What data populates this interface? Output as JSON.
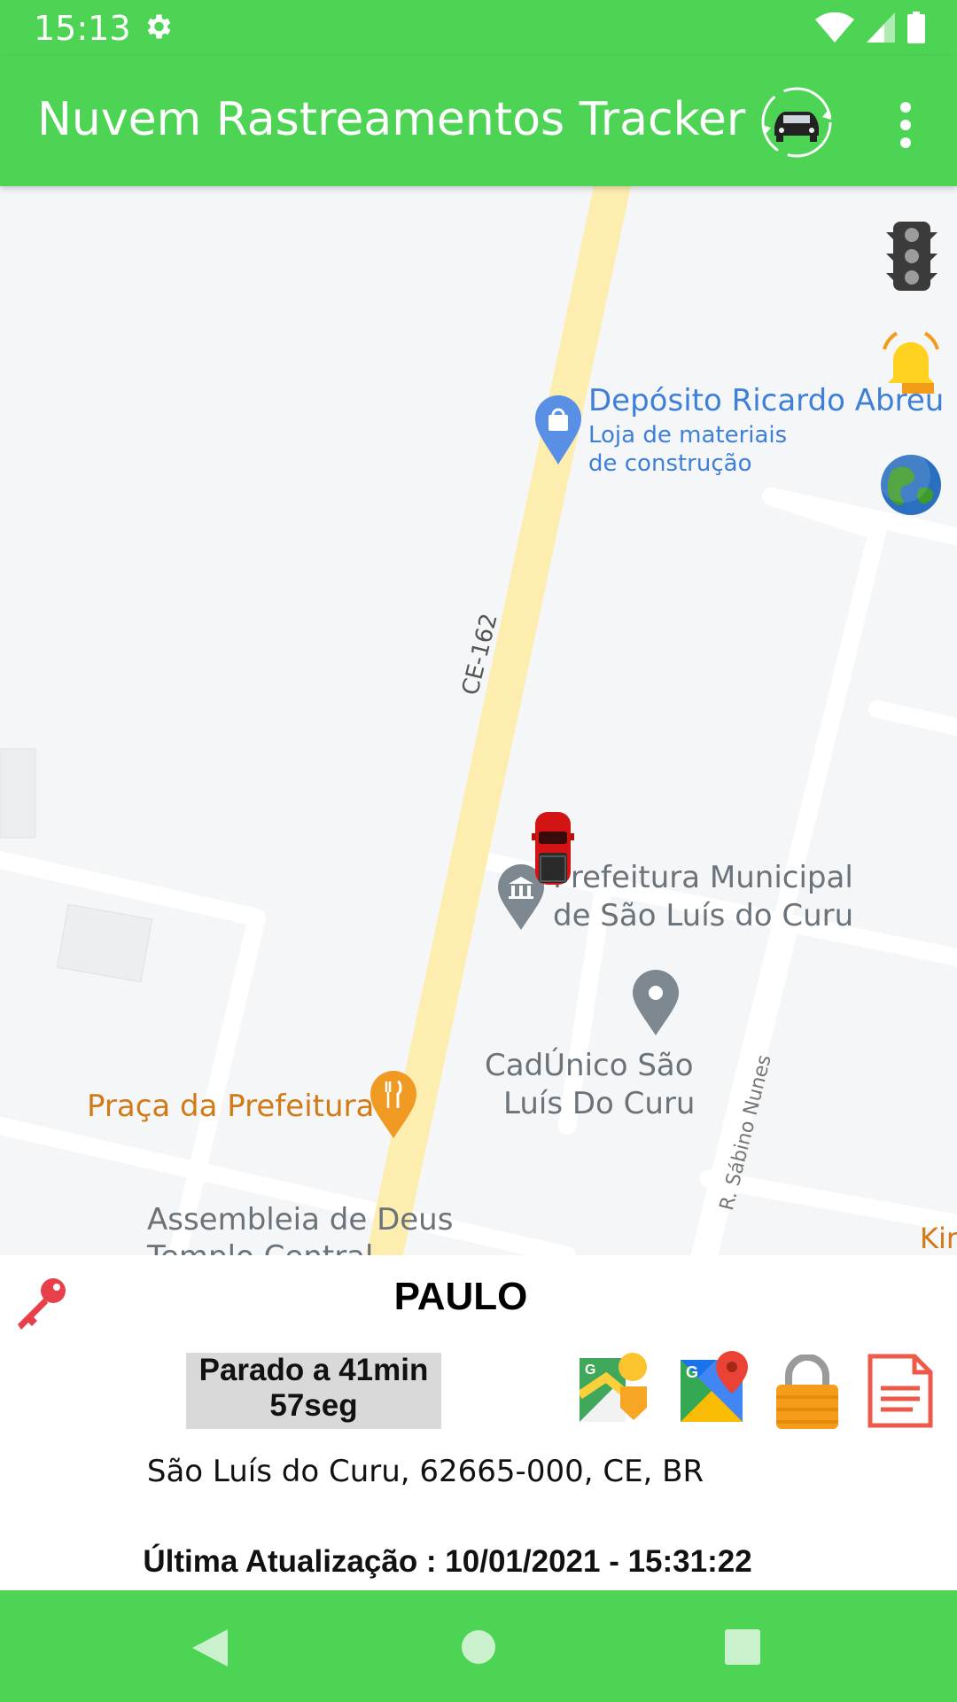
{
  "status_bar": {
    "time": "15:13"
  },
  "app_bar": {
    "title": "Nuvem Rastreamentos Tracker"
  },
  "map": {
    "road_label": "CE-162",
    "street_label": "R. Sábino Nunes",
    "pois": {
      "deposito": {
        "name": "Depósito Ricardo Abreu",
        "cat1": "Loja de materiais",
        "cat2": "de construção"
      },
      "prefeitura": {
        "line1": "Prefeitura Municipal",
        "line2": "de São Luís do Curu"
      },
      "cadunico": {
        "line1": "CadÚnico São",
        "line2": "Luís Do Curu"
      },
      "praca": {
        "name": "Praça da Prefeitura"
      },
      "assembleia": {
        "line1": "Assembleia de Deus",
        "line2": "Templo Central"
      },
      "edge": {
        "name": "Kir"
      }
    }
  },
  "vehicle_panel": {
    "name": "PAULO",
    "status_line1": "Parado a 41min",
    "status_line2": "57seg",
    "address": "São Luís do Curu, 62665-000, CE, BR",
    "last_update": "Última Atualização : 10/01/2021 - 15:31:22"
  },
  "colors": {
    "accent": "#4ed454"
  },
  "icons": [
    "settings-icon",
    "wifi-icon",
    "signal-icon",
    "battery-icon",
    "car-refresh-icon",
    "more-vert-icon",
    "traffic-light-icon",
    "bell-icon",
    "globe-icon",
    "key-icon",
    "street-view-icon",
    "google-maps-icon",
    "lock-icon",
    "report-icon",
    "back-icon",
    "home-icon",
    "recents-icon"
  ]
}
